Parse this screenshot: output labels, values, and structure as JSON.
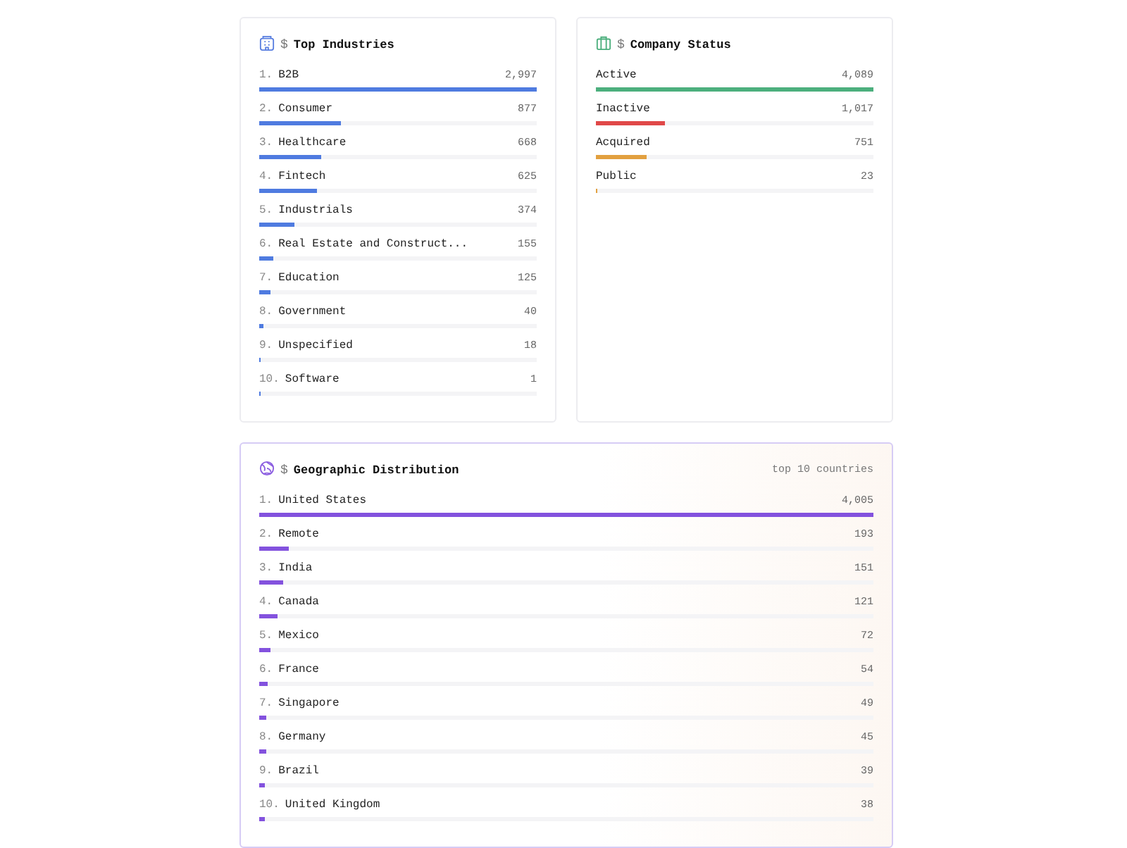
{
  "top_industries": {
    "prefix": "$",
    "title": "Top Industries",
    "items": [
      {
        "rank": "1.",
        "label": "B2B",
        "value": "2,997",
        "level": 1.0
      },
      {
        "rank": "2.",
        "label": "Consumer",
        "value": "877",
        "level": 0.293
      },
      {
        "rank": "3.",
        "label": "Healthcare",
        "value": "668",
        "level": 0.223
      },
      {
        "rank": "4.",
        "label": "Fintech",
        "value": "625",
        "level": 0.209
      },
      {
        "rank": "5.",
        "label": "Industrials",
        "value": "374",
        "level": 0.125
      },
      {
        "rank": "6.",
        "label": "Real Estate and Construct...",
        "value": "155",
        "level": 0.052
      },
      {
        "rank": "7.",
        "label": "Education",
        "value": "125",
        "level": 0.042
      },
      {
        "rank": "8.",
        "label": "Government",
        "value": "40",
        "level": 0.013
      },
      {
        "rank": "9.",
        "label": "Unspecified",
        "value": "18",
        "level": 0.006
      },
      {
        "rank": "10.",
        "label": "Software",
        "value": "1",
        "level": 0.0003
      }
    ]
  },
  "company_status": {
    "prefix": "$",
    "title": "Company Status",
    "items": [
      {
        "label": "Active",
        "value": "4,089",
        "level": 1.0,
        "color": "#4caf7d"
      },
      {
        "label": "Inactive",
        "value": "1,017",
        "level": 0.249,
        "color": "#e04848"
      },
      {
        "label": "Acquired",
        "value": "751",
        "level": 0.184,
        "color": "#e2a03f"
      },
      {
        "label": "Public",
        "value": "23",
        "level": 0.006,
        "color": "#e2a03f"
      }
    ]
  },
  "geographic_distribution": {
    "prefix": "$",
    "title": "Geographic Distribution",
    "note": "top 10 countries",
    "items": [
      {
        "rank": "1.",
        "label": "United States",
        "value": "4,005",
        "level": 1.0
      },
      {
        "rank": "2.",
        "label": "Remote",
        "value": "193",
        "level": 0.048
      },
      {
        "rank": "3.",
        "label": "India",
        "value": "151",
        "level": 0.038
      },
      {
        "rank": "4.",
        "label": "Canada",
        "value": "121",
        "level": 0.03
      },
      {
        "rank": "5.",
        "label": "Mexico",
        "value": "72",
        "level": 0.018
      },
      {
        "rank": "6.",
        "label": "France",
        "value": "54",
        "level": 0.0135
      },
      {
        "rank": "7.",
        "label": "Singapore",
        "value": "49",
        "level": 0.012
      },
      {
        "rank": "8.",
        "label": "Germany",
        "value": "45",
        "level": 0.011
      },
      {
        "rank": "9.",
        "label": "Brazil",
        "value": "39",
        "level": 0.0097
      },
      {
        "rank": "10.",
        "label": "United Kingdom",
        "value": "38",
        "level": 0.0095
      }
    ]
  }
}
